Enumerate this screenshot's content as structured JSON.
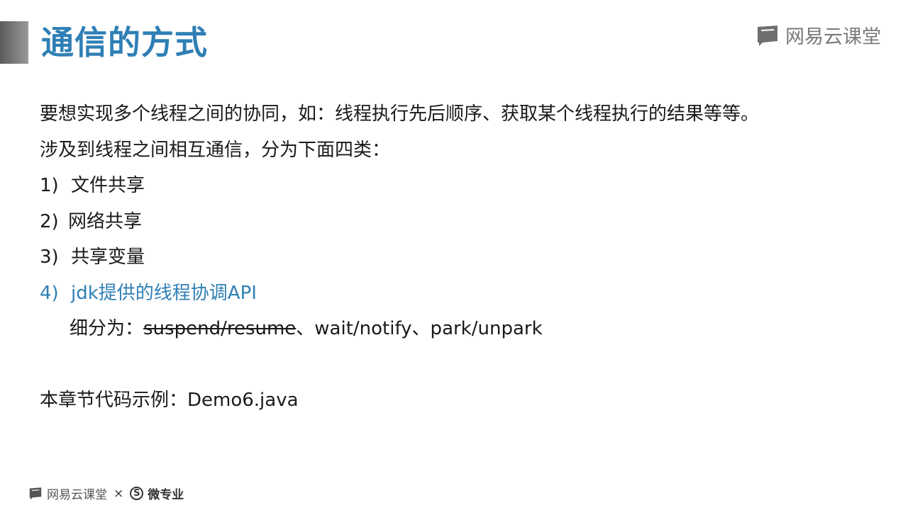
{
  "title": "通信的方式",
  "brand": "网易云课堂",
  "intro": "要想实现多个线程之间的协同，如：线程执行先后顺序、获取某个线程执行的结果等等。",
  "lead": "涉及到线程之间相互通信，分为下面四类：",
  "items": [
    {
      "num": "1)",
      "text": "文件共享"
    },
    {
      "num": "2)",
      "text": "网络共享"
    },
    {
      "num": "3)",
      "text": "共享变量"
    },
    {
      "num": "4)",
      "text": "jdk提供的线程协调API"
    }
  ],
  "subdivide": {
    "prefix": "细分为：",
    "struck": "suspend/resume",
    "rest": "、wait/notify、park/unpark"
  },
  "example": "本章节代码示例：Demo6.java",
  "footer": {
    "brand": "网易云课堂",
    "times": "×",
    "wz_symbol": "S",
    "wz_text": "微专业"
  },
  "colors": {
    "accent": "#2f7fb5",
    "brand_gray": "#7a7a7a"
  }
}
